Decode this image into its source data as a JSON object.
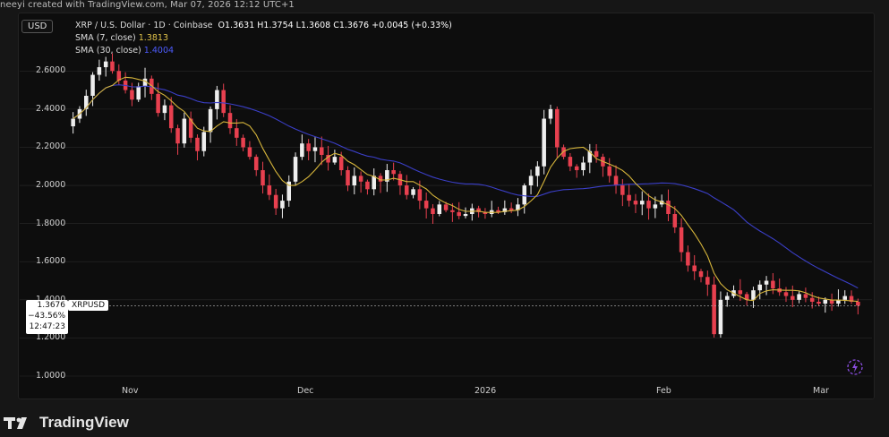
{
  "credit": "neeyi created with TradingView.com, Mar 07, 2026 12:12 UTC+1",
  "currency_button": "USD",
  "header": {
    "title": "XRP / U.S. Dollar · 1D · Coinbase",
    "ohlc": "O1.3631 H1.3754 L1.3608 C1.3676 +0.0045 (+0.33%)",
    "sma7_label": "SMA (7, close)",
    "sma7_value": "1.3813",
    "sma30_label": "SMA (30, close)",
    "sma30_value": "1.4004"
  },
  "price_tag": {
    "price": "1.3676",
    "change": "−43.56%",
    "countdown": "12:47:23",
    "symbol": "XRPUSD"
  },
  "brand": "TradingView",
  "colors": {
    "up": "#eeeeee",
    "down": "#e8404f",
    "sma7": "#d6b53b",
    "sma30": "#3b3fc8",
    "grid": "#2a2a2a"
  },
  "chart_data": {
    "type": "candlestick",
    "y_ticks": [
      "2.6000",
      "2.4000",
      "2.2000",
      "2.0000",
      "1.8000",
      "1.6000",
      "1.4000",
      "1.2000",
      "1.0000"
    ],
    "x_ticks": [
      "Nov",
      "Dec",
      "2026",
      "Feb",
      "Mar"
    ],
    "ylim": [
      1.0,
      2.7
    ],
    "current_price": 1.3676,
    "close_series": [
      2.35,
      2.4,
      2.47,
      2.58,
      2.62,
      2.65,
      2.6,
      2.55,
      2.5,
      2.45,
      2.52,
      2.56,
      2.48,
      2.38,
      2.42,
      2.3,
      2.22,
      2.35,
      2.25,
      2.18,
      2.28,
      2.4,
      2.5,
      2.38,
      2.3,
      2.25,
      2.2,
      2.15,
      2.08,
      2.0,
      1.95,
      1.88,
      1.92,
      2.02,
      2.15,
      2.22,
      2.18,
      2.2,
      2.16,
      2.12,
      2.15,
      2.08,
      2.0,
      2.05,
      2.02,
      1.98,
      2.05,
      2.02,
      2.08,
      2.06,
      2.0,
      1.95,
      1.98,
      1.92,
      1.88,
      1.85,
      1.9,
      1.87,
      1.86,
      1.84,
      1.85,
      1.88,
      1.86,
      1.85,
      1.87,
      1.86,
      1.88,
      1.87,
      1.9,
      2.0,
      2.05,
      2.1,
      2.35,
      2.4,
      2.2,
      2.15,
      2.1,
      2.08,
      2.12,
      2.18,
      2.15,
      2.1,
      2.05,
      2.0,
      1.95,
      1.92,
      1.9,
      1.92,
      1.88,
      1.9,
      1.92,
      1.85,
      1.78,
      1.65,
      1.58,
      1.55,
      1.52,
      1.48,
      1.22,
      1.4,
      1.42,
      1.45,
      1.43,
      1.4,
      1.45,
      1.48,
      1.5,
      1.46,
      1.44,
      1.42,
      1.4,
      1.43,
      1.41,
      1.39,
      1.38,
      1.4,
      1.38,
      1.4,
      1.42,
      1.39,
      1.37
    ]
  }
}
